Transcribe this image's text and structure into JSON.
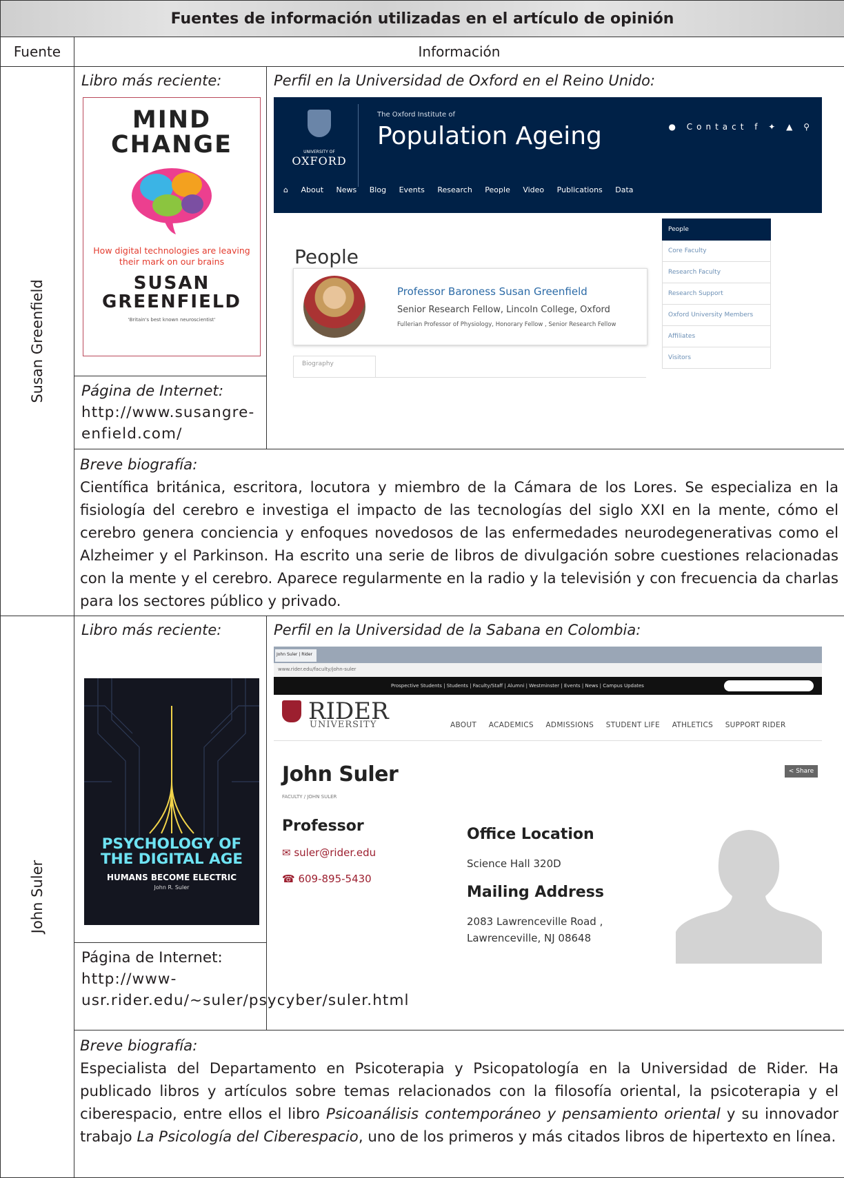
{
  "table": {
    "title": "Fuentes de información utilizadas en el artículo de opinión",
    "col_fuente": "Fuente",
    "col_informacion": "Información"
  },
  "rows": [
    {
      "source": "Susan Greenfield",
      "book_label": "Libro más reciente:",
      "profile_label": "Perfil en la Universidad de Oxford en el Reino Unido:",
      "web_label": "Página de Internet:",
      "web_url": "http://www.susangre-enfield.com/",
      "bio_label": "Breve biografía:",
      "bio_text": "Científica británica, escritora, locutora y miembro de la Cámara de los Lores. Se especializa en la fisiología del cerebro e investiga el impacto de las tecnologías del siglo XXI en la mente, cómo el cerebro genera conciencia y enfoques novedosos de las enfermedades neurodegenerativas como el Alzheimer y el Parkinson. Ha escrito una serie de libros de divulgación sobre cuestiones relacionadas con la mente y el cerebro. Aparece regularmente en la radio y la televisión y con frecuencia da charlas para los sectores público y privado.",
      "book": {
        "title1": "MIND",
        "title2": "CHANGE",
        "subtitle": "How digital technologies are leaving their mark on our brains",
        "author1": "SUSAN",
        "author2": "GREENFIELD",
        "quote": "'Britain's best known neuroscientist'"
      },
      "profile": {
        "institute": "The Oxford Institute of",
        "brand": "Population Ageing",
        "university_small": "UNIVERSITY OF",
        "university": "OXFORD",
        "contact": "Contact",
        "nav": [
          "About",
          "News",
          "Blog",
          "Events",
          "Research",
          "People",
          "Video",
          "Publications",
          "Data"
        ],
        "people_heading": "People",
        "person_name": "Professor Baroness Susan Greenfield",
        "person_role": "Senior Research Fellow, Lincoln College, Oxford",
        "person_sub": "Fullerian Professor of Physiology, Honorary Fellow , Senior Research Fellow",
        "tab": "Biography",
        "sidebar": [
          "People",
          "Core Faculty",
          "Research Faculty",
          "Research Support",
          "Oxford University Members",
          "Affiliates",
          "Visitors"
        ]
      }
    },
    {
      "source": "John Suler",
      "book_label": "Libro más reciente:",
      "profile_label": "Perfil en la Universidad de la Sabana en Colombia:",
      "web_label": "Página de Internet:",
      "web_url": "http://www-usr.rider.edu/~suler/psycyber/suler.html",
      "bio_label": "Breve biografía:",
      "bio_text_1": "Especialista del Departamento en Psicoterapia y Psicopatología en la Universidad de Rider. Ha publicado libros y artículos sobre temas relacionados con la filosofía oriental, la psicoterapia y el ciberespacio, entre ellos el libro ",
      "bio_italic_1": "Psicoanálisis contemporáneo y pensamiento oriental",
      "bio_text_2": " y su innovador trabajo ",
      "bio_italic_2": "La Psicología del Ciberespacio",
      "bio_text_3": ", uno de los primeros y más citados libros de hipertexto en línea.",
      "book": {
        "title1": "PSYCHOLOGY OF",
        "title2": "THE DIGITAL AGE",
        "subtitle": "HUMANS BECOME ELECTRIC",
        "author": "John R. Suler"
      },
      "profile": {
        "address": "www.rider.edu/faculty/john-suler",
        "utility_nav": "Prospective Students | Students | Faculty/Staff | Alumni | Westminster | Events | News | Campus Updates",
        "logo_main": "RIDER",
        "logo_sub": "UNIVERSITY",
        "nav": [
          "ABOUT",
          "ACADEMICS",
          "ADMISSIONS",
          "STUDENT LIFE",
          "ATHLETICS",
          "SUPPORT RIDER"
        ],
        "name": "John Suler",
        "breadcrumb": "FACULTY / JOHN SULER",
        "share": "Share",
        "title": "Professor",
        "email": "suler@rider.edu",
        "phone": "609-895-5430",
        "office_heading": "Office Location",
        "office": "Science Hall 320D",
        "mailing_heading": "Mailing Address",
        "address1": "2083 Lawrenceville Road ,",
        "address2": "Lawrenceville, NJ 08648"
      }
    }
  ]
}
